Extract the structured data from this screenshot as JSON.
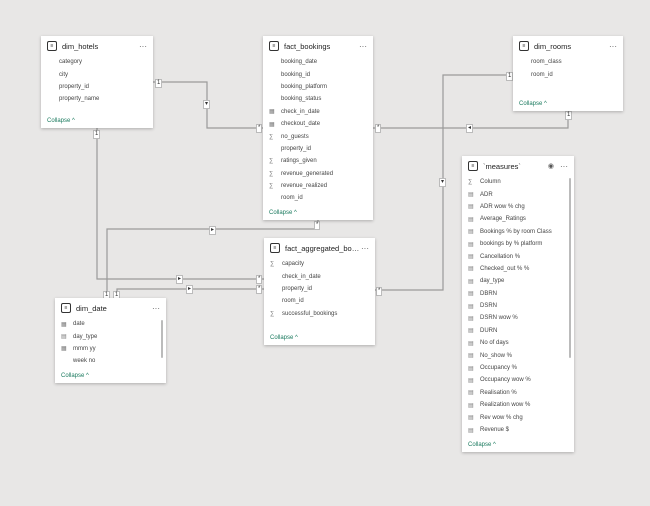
{
  "tables": {
    "dim_hotels": {
      "title": "dim_hotels",
      "fields": [
        {
          "name": "category",
          "icon": ""
        },
        {
          "name": "city",
          "icon": ""
        },
        {
          "name": "property_id",
          "icon": ""
        },
        {
          "name": "property_name",
          "icon": ""
        }
      ],
      "collapse": "Collapse"
    },
    "fact_bookings": {
      "title": "fact_bookings",
      "fields": [
        {
          "name": "booking_date",
          "icon": ""
        },
        {
          "name": "booking_id",
          "icon": ""
        },
        {
          "name": "booking_platform",
          "icon": ""
        },
        {
          "name": "booking_status",
          "icon": ""
        },
        {
          "name": "check_in_date",
          "icon": "calendar"
        },
        {
          "name": "checkout_date",
          "icon": "calendar"
        },
        {
          "name": "no_guests",
          "icon": "sigma"
        },
        {
          "name": "property_id",
          "icon": ""
        },
        {
          "name": "ratings_given",
          "icon": "sigma"
        },
        {
          "name": "revenue_generated",
          "icon": "sigma"
        },
        {
          "name": "revenue_realized",
          "icon": "sigma"
        },
        {
          "name": "room_id",
          "icon": ""
        }
      ],
      "collapse": "Collapse"
    },
    "dim_rooms": {
      "title": "dim_rooms",
      "fields": [
        {
          "name": "room_class",
          "icon": ""
        },
        {
          "name": "room_id",
          "icon": ""
        }
      ],
      "collapse": "Collapse"
    },
    "measures": {
      "title": "`measures`",
      "fields": [
        {
          "name": "Column",
          "icon": "sigma"
        },
        {
          "name": "ADR",
          "icon": "calc"
        },
        {
          "name": "ADR wow % chg",
          "icon": "calc"
        },
        {
          "name": "Average_Ratings",
          "icon": "calc"
        },
        {
          "name": "Bookings % by room Class",
          "icon": "calc"
        },
        {
          "name": "bookings by % platform",
          "icon": "calc"
        },
        {
          "name": "Cancellation %",
          "icon": "calc"
        },
        {
          "name": "Checked_out % %",
          "icon": "calc"
        },
        {
          "name": "day_type",
          "icon": "calc"
        },
        {
          "name": "DBRN",
          "icon": "calc"
        },
        {
          "name": "DSRN",
          "icon": "calc"
        },
        {
          "name": "DSRN wow %",
          "icon": "calc"
        },
        {
          "name": "DURN",
          "icon": "calc"
        },
        {
          "name": "No of days",
          "icon": "calc"
        },
        {
          "name": "No_show %",
          "icon": "calc"
        },
        {
          "name": "Occupancy %",
          "icon": "calc"
        },
        {
          "name": "Occupancy wow %",
          "icon": "calc"
        },
        {
          "name": "Realisation %",
          "icon": "calc"
        },
        {
          "name": "Realization wow %",
          "icon": "calc"
        },
        {
          "name": "Rev wow % chg",
          "icon": "calc"
        },
        {
          "name": "Revenue $",
          "icon": "calc"
        }
      ],
      "collapse": "Collapse"
    },
    "fact_aggregated": {
      "title": "fact_aggregated_booki...",
      "fields": [
        {
          "name": "capacity",
          "icon": "sigma"
        },
        {
          "name": "check_in_date",
          "icon": ""
        },
        {
          "name": "property_id",
          "icon": ""
        },
        {
          "name": "room_id",
          "icon": ""
        },
        {
          "name": "successful_bookings",
          "icon": "sigma"
        }
      ],
      "collapse": "Collapse"
    },
    "dim_date": {
      "title": "dim_date",
      "fields": [
        {
          "name": "date",
          "icon": "calendar"
        },
        {
          "name": "day_type",
          "icon": "calc"
        },
        {
          "name": "mmm yy",
          "icon": "calendar"
        },
        {
          "name": "week no",
          "icon": ""
        }
      ],
      "collapse": "Collapse"
    }
  },
  "cardinality": {
    "one": "1",
    "many": "*"
  }
}
